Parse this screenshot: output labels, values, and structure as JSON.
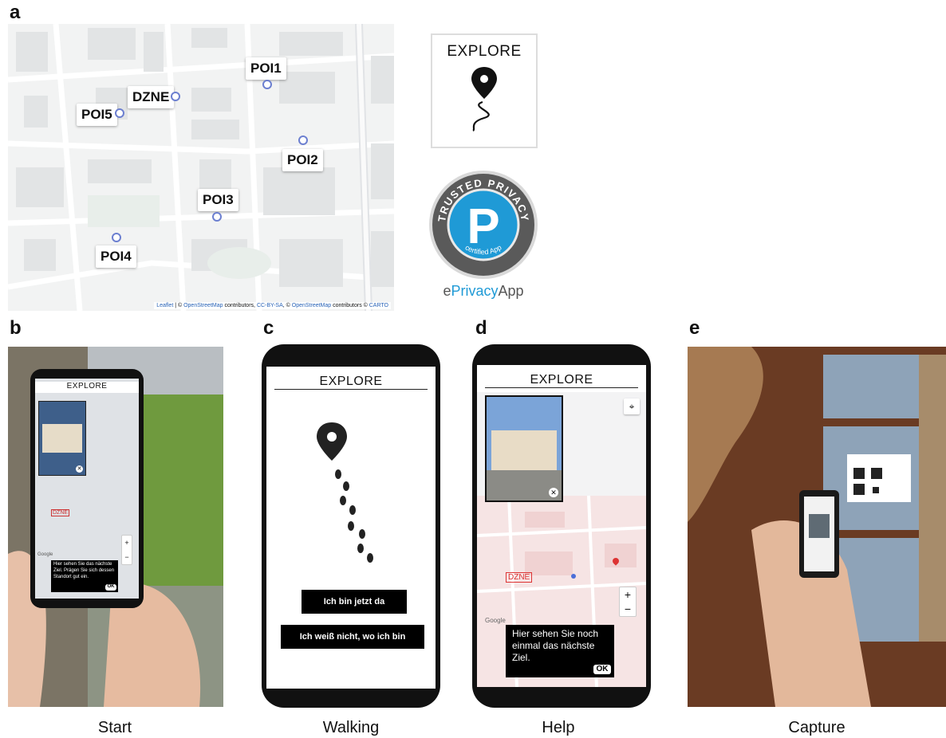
{
  "panels": {
    "a": "a",
    "b": "b",
    "c": "c",
    "d": "d",
    "e": "e"
  },
  "map": {
    "pois": [
      {
        "label": "POI1"
      },
      {
        "label": "DZNE"
      },
      {
        "label": "POI5"
      },
      {
        "label": "POI2"
      },
      {
        "label": "POI3"
      },
      {
        "label": "POI4"
      }
    ],
    "attribution": {
      "leaflet": "Leaflet",
      "sep1": " | © ",
      "osm1": "OpenStreetMap",
      "mid": " contributors, ",
      "ccbysa": "CC-BY-SA",
      "mid2": ", © ",
      "osm2": "OpenStreetMap",
      "mid3": " contributors © ",
      "carto": "CARTO"
    }
  },
  "explore_logo": {
    "title": "EXPLORE"
  },
  "privacy_badge": {
    "top_text": "TRUSTED PRIVACY",
    "letter": "P",
    "bottom_text": "certified App",
    "brand_e": "e",
    "brand_privacy": "Privacy",
    "brand_app": "App",
    "colors": {
      "ring": "#5a5a5a",
      "inner": "#1f9ad6",
      "brand": "#1f9ad6"
    }
  },
  "phone_b": {
    "title": "EXPLORE",
    "map_tag": "DZNE",
    "google": "Google",
    "message": "Hier sehen Sie das nächste Ziel. Prägen Sie sich dessen Standort gut ein.",
    "ok": "OK"
  },
  "phone_c": {
    "title": "EXPLORE",
    "button_here": "Ich bin jetzt da",
    "button_lost": "Ich weiß nicht, wo ich bin"
  },
  "phone_d": {
    "title": "EXPLORE",
    "map_tag": "DZNE",
    "google": "Google",
    "zoom_in": "+",
    "zoom_out": "−",
    "message": "Hier sehen Sie noch einmal das nächste Ziel.",
    "ok": "OK"
  },
  "captions": {
    "b": "Start",
    "c": "Walking",
    "d": "Help",
    "e": "Capture"
  }
}
